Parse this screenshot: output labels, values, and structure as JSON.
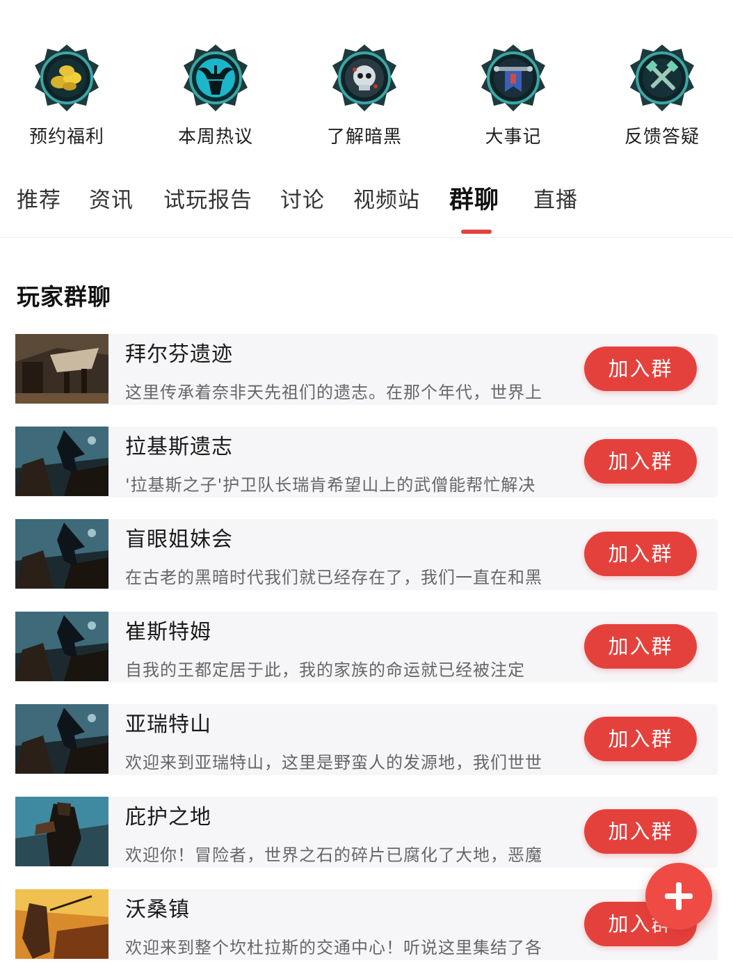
{
  "shortcuts": [
    {
      "label": "预约福利",
      "icon": "gold-coins-icon",
      "accent": "#e8c23a"
    },
    {
      "label": "本周热议",
      "icon": "demon-horns-icon",
      "accent": "#2ec9d6"
    },
    {
      "label": "了解暗黑",
      "icon": "skull-icon",
      "accent": "#b7c6d4"
    },
    {
      "label": "大事记",
      "icon": "banner-icon",
      "accent": "#5b7fd6"
    },
    {
      "label": "反馈答疑",
      "icon": "crossed-hammers-icon",
      "accent": "#6fd0b0"
    }
  ],
  "tabs": [
    "推荐",
    "资讯",
    "试玩报告",
    "讨论",
    "视频站",
    "群聊",
    "直播"
  ],
  "active_tab": "群聊",
  "section": {
    "title": "玩家群聊"
  },
  "join_label": "加入群",
  "groups": [
    {
      "name": "拜尔芬遗迹",
      "desc": "这里传承着奈非天先祖们的遗志。在那个年代，世界上",
      "thumb": "ruins"
    },
    {
      "name": "拉基斯遗志",
      "desc": "'拉基斯之子'护卫队长瑞肯希望山上的武僧能帮忙解决",
      "thumb": "battle"
    },
    {
      "name": "盲眼姐妹会",
      "desc": "在古老的黑暗时代我们就已经存在了，我们一直在和黑",
      "thumb": "battle"
    },
    {
      "name": "崔斯特姆",
      "desc": "自我的王都定居于此，我的家族的命运就已经被注定",
      "thumb": "battle"
    },
    {
      "name": "亚瑞特山",
      "desc": "欢迎来到亚瑞特山，这里是野蛮人的发源地，我们世世",
      "thumb": "battle"
    },
    {
      "name": "庇护之地",
      "desc": "欢迎你！冒险者，世界之石的碎片已腐化了大地，恶魔",
      "thumb": "hunter"
    },
    {
      "name": "沃桑镇",
      "desc": "欢迎来到整个坎杜拉斯的交通中心！听说这里集结了各",
      "thumb": "fire"
    }
  ],
  "colors": {
    "accent_red": "#e5413c",
    "row_bg": "#f6f6f9"
  }
}
